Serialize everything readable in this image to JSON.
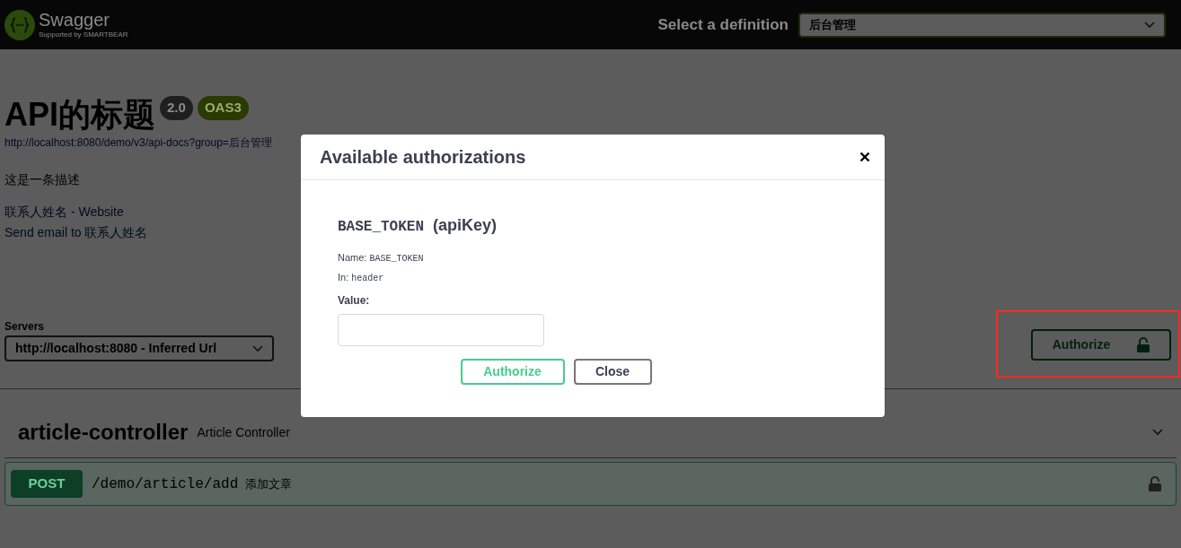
{
  "header": {
    "logo_text": "Swagger",
    "logo_subtext": "Supported by SMARTBEAR",
    "definition_label": "Select a definition",
    "definition_value": "后台管理"
  },
  "info": {
    "title": "API的标题",
    "badges": [
      {
        "text": "2.0",
        "kind": "version"
      },
      {
        "text": "OAS3",
        "kind": "oas"
      }
    ],
    "url": "http://localhost:8080/demo/v3/api-docs?group=后台管理",
    "description": "这是一条描述",
    "contact_link": "联系人姓名 - Website",
    "email_link": "Send email to 联系人姓名"
  },
  "servers": {
    "label": "Servers",
    "value": "http://localhost:8080 - Inferred Url"
  },
  "authorize_button": {
    "label": "Authorize"
  },
  "tags": [
    {
      "name": "article-controller",
      "description": "Article Controller",
      "operations": [
        {
          "method": "POST",
          "path": "/demo/article/add",
          "summary": "添加文章"
        }
      ]
    }
  ],
  "modal": {
    "title": "Available authorizations",
    "scheme_name": "BASE_TOKEN",
    "scheme_type": "(apiKey)",
    "name_label": "Name:",
    "name_value": "BASE_TOKEN",
    "in_label": "In:",
    "in_value": "header",
    "value_label": "Value:",
    "buttons": [
      {
        "label": "Authorize",
        "kind": "primary"
      },
      {
        "label": "Close",
        "kind": "secondary"
      }
    ]
  }
}
